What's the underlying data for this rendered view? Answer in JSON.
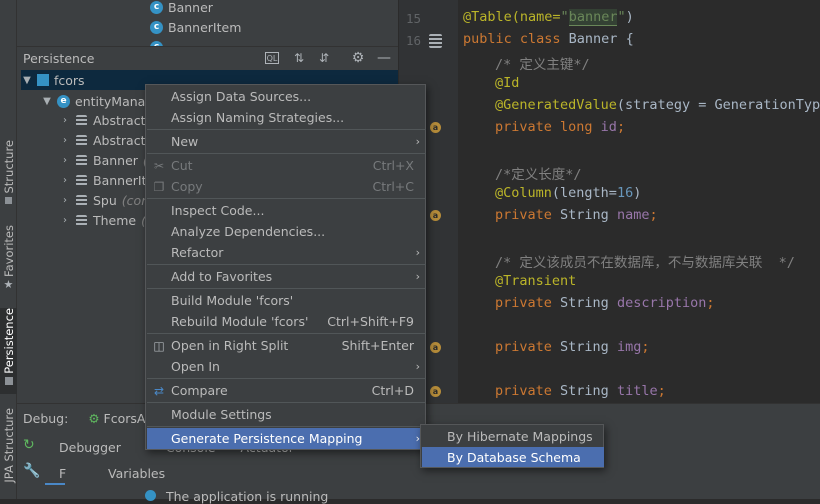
{
  "colors": {
    "accent": "#4b6eaf",
    "background": "#2b2b2b",
    "panel": "#3c3f41"
  },
  "left_strip": {
    "structure": "Structure",
    "favorites": "Favorites",
    "persistence": "Persistence",
    "jpa_structure": "JPA Structure"
  },
  "top_tree": {
    "items": [
      "Banner",
      "BannerItem"
    ]
  },
  "persistence_panel": {
    "title": "Persistence",
    "root": "fcors",
    "entity_manager": "entityManag",
    "entities": [
      {
        "label": "Abstract"
      },
      {
        "label": "Abstract"
      },
      {
        "label": "Banner",
        "suffix": "("
      },
      {
        "label": "BannerIt"
      },
      {
        "label": "Spu",
        "suffix": "(cor"
      },
      {
        "label": "Theme",
        "suffix": "("
      }
    ]
  },
  "editor": {
    "line_numbers": [
      "15",
      "16"
    ],
    "lines": {
      "l15a": "@Table(name=",
      "l15b": "\"",
      "l15c": "banner",
      "l15d": "\"",
      "l15e": ")",
      "l16a": "public class ",
      "l16b": "Banner {",
      "c1": "/* 定义主键*/",
      "id_ann": "@Id",
      "gen_ann": "@GeneratedValue",
      "gen_rest": "(strategy = GenerationType",
      "priv": "private ",
      "long_t": "long ",
      "id_f": "id",
      "semi": ";",
      "c2": "/*定义长度*/",
      "col_ann": "@Column",
      "col_rest": "(length=",
      "col_num": "16",
      "col_end": ")",
      "string_t": "String ",
      "name_f": "name",
      "c3": "/* 定义该成员不在数据库，不与数据库关联  */",
      "trans_ann": "@Transient",
      "desc_f": "description",
      "img_f": "img",
      "title_f": "title"
    }
  },
  "debug": {
    "label": "Debug:",
    "config": "FcorsAp",
    "tab_debugger": "Debugger",
    "tab_console": "Console",
    "tab_actuator": "Actuator",
    "frames": "F",
    "variables": "Variables",
    "status": "The application is running"
  },
  "context_menu": {
    "assign_data_sources": "Assign Data Sources...",
    "assign_naming": "Assign Naming Strategies...",
    "new": "New",
    "cut": "Cut",
    "cut_sc": "Ctrl+X",
    "copy": "Copy",
    "copy_sc": "Ctrl+C",
    "inspect": "Inspect Code...",
    "analyze": "Analyze Dependencies...",
    "refactor": "Refactor",
    "add_fav": "Add to Favorites",
    "build": "Build Module 'fcors'",
    "rebuild": "Rebuild Module 'fcors'",
    "rebuild_sc": "Ctrl+Shift+F9",
    "open_split": "Open in Right Split",
    "open_split_sc": "Shift+Enter",
    "open_in": "Open In",
    "compare": "Compare",
    "compare_sc": "Ctrl+D",
    "module_settings": "Module Settings",
    "generate": "Generate Persistence Mapping"
  },
  "submenu": {
    "hibernate": "By Hibernate Mappings",
    "db_schema": "By Database Schema"
  }
}
